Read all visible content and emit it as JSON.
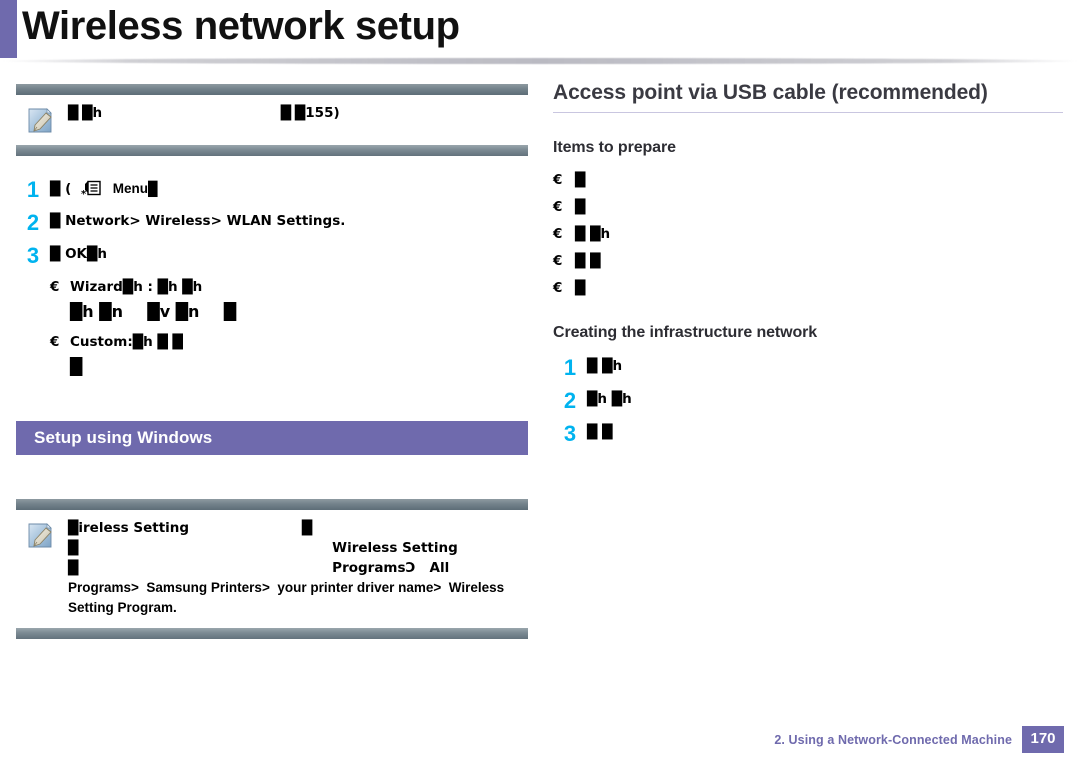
{
  "header": {
    "title": "Wireless network setup",
    "accent_color": "#6f6aad"
  },
  "left_column": {
    "top_note": {
      "icon": "note-pencil-icon",
      "lines": [
        "█",
        "█h                                      █",
        "█155)"
      ]
    },
    "steps": [
      {
        "number": "1",
        "prefix": "█   (",
        "icon": "menu-list-icon",
        "text": "Menu█"
      },
      {
        "number": "2",
        "text": "█      Network>  Wireless>  WLAN Settings."
      },
      {
        "number": "3",
        "text": "█             OK█h"
      }
    ],
    "sub_items": [
      {
        "mark": "€",
        "text": "Wizard█h                         : █h                          █h",
        "continuations": [
          "█h                                  █n",
          "█v                                  █n",
          "█"
        ]
      },
      {
        "mark": "€",
        "text": "Custom:█h                    █              █",
        "continuations": [
          "█"
        ]
      }
    ],
    "section_banner": "Setup using Windows",
    "bottom_note": {
      "icon": "note-pencil-icon",
      "lines": [
        "█ireless Setting                        █",
        "█                                                      Wireless Setting",
        "█                                                      ProgramsƆ   All",
        "Programs>  Samsung Printers>  your printer driver name>  Wireless",
        "Setting Program."
      ]
    }
  },
  "right_column": {
    "heading": "Access point via USB cable (recommended)",
    "items_to_prepare": {
      "heading": "Items to prepare",
      "bullets": [
        {
          "mark": "€",
          "text": "█"
        },
        {
          "mark": "€",
          "text": "█"
        },
        {
          "mark": "€",
          "text": "█                                   █h"
        },
        {
          "mark": "€",
          "text": "█                                             █"
        },
        {
          "mark": "€",
          "text": "█"
        }
      ]
    },
    "creating_network": {
      "heading": "Creating the infrastructure network",
      "steps": [
        {
          "number": "1",
          "text": "█                                        █h"
        },
        {
          "number": "2",
          "text": "█h                            █h"
        },
        {
          "number": "3",
          "text": "█                                  █"
        }
      ]
    }
  },
  "footer": {
    "chapter": "2.  Using a Network-Connected Machine",
    "page_number": "170",
    "accent_color": "#6f6aad"
  }
}
